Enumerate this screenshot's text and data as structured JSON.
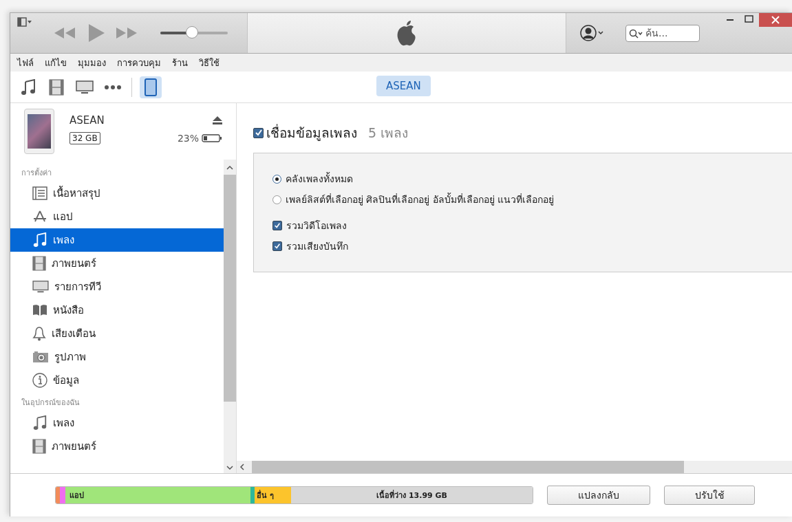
{
  "player": {
    "volume": {
      "level": 0.48
    }
  },
  "search": {
    "placeholder": "ค้น..."
  },
  "menu": [
    "ไฟล์",
    "แก้ไข",
    "มุมมอง",
    "การควบคุม",
    "ร้าน",
    "วิธีใช้"
  ],
  "media_tabs": [
    {
      "kind": "music",
      "selected": false
    },
    {
      "kind": "movie",
      "selected": false
    },
    {
      "kind": "tv",
      "selected": false
    },
    {
      "kind": "more",
      "selected": false
    },
    {
      "kind": "tablet",
      "selected": true
    }
  ],
  "device_button": "ASEAN",
  "device": {
    "name": "ASEAN",
    "capacity": "32 GB",
    "battery": "23%"
  },
  "sidebar": [
    {
      "heading": "การตั้งค่า",
      "items": [
        {
          "kind": "summary",
          "label": "เนื้อหาสรุป",
          "selected": false
        },
        {
          "kind": "app",
          "label": "แอป",
          "selected": false
        },
        {
          "kind": "music",
          "label": "เพลง",
          "selected": true
        },
        {
          "kind": "movie",
          "label": "ภาพยนตร์",
          "selected": false
        },
        {
          "kind": "tv",
          "label": "รายการทีวี",
          "selected": false
        },
        {
          "kind": "book",
          "label": "หนังสือ",
          "selected": false
        },
        {
          "kind": "tone",
          "label": "เสียงเตือน",
          "selected": false
        },
        {
          "kind": "photo",
          "label": "รูปภาพ",
          "selected": false
        },
        {
          "kind": "info",
          "label": "ข้อมูล",
          "selected": false
        }
      ]
    },
    {
      "heading": "ในอุปกรณ์ของฉัน",
      "items": [
        {
          "kind": "music",
          "label": "เพลง",
          "selected": false
        },
        {
          "kind": "movie",
          "label": "ภาพยนตร์",
          "selected": false
        }
      ]
    }
  ],
  "sync": {
    "label": "เชื่อมข้อมูลเพลง",
    "checked": true,
    "count": "5 เพลง",
    "options": [
      {
        "label": "คลังเพลงทั้งหมด",
        "selected": true
      },
      {
        "label": "เพลย์ลิสต์ที่เลือกอยู่ ศิลปินที่เลือกอยู่ อัลบั้มที่เลือกอยู่ แนวที่เลือกอยู่",
        "selected": false
      }
    ],
    "checkboxes": [
      {
        "label": "รวมวิดีโอเพลง",
        "checked": true
      },
      {
        "label": "รวมเสียงบันทึก",
        "checked": true
      }
    ]
  },
  "storage": [
    {
      "color": "#f28c5a"
    },
    {
      "color": "#f06ef0"
    },
    {
      "label": "แอป",
      "color": "#a0e57a"
    },
    {
      "color": "#2db89a"
    },
    {
      "label": "อื่น ๆ",
      "color": "#fcc42c"
    },
    {
      "label": "เนื้อที่ว่าง 13.99 GB",
      "color": "#d8d8d8"
    }
  ],
  "buttons": [
    "แปลงกลับ",
    "ปรับใช้"
  ]
}
